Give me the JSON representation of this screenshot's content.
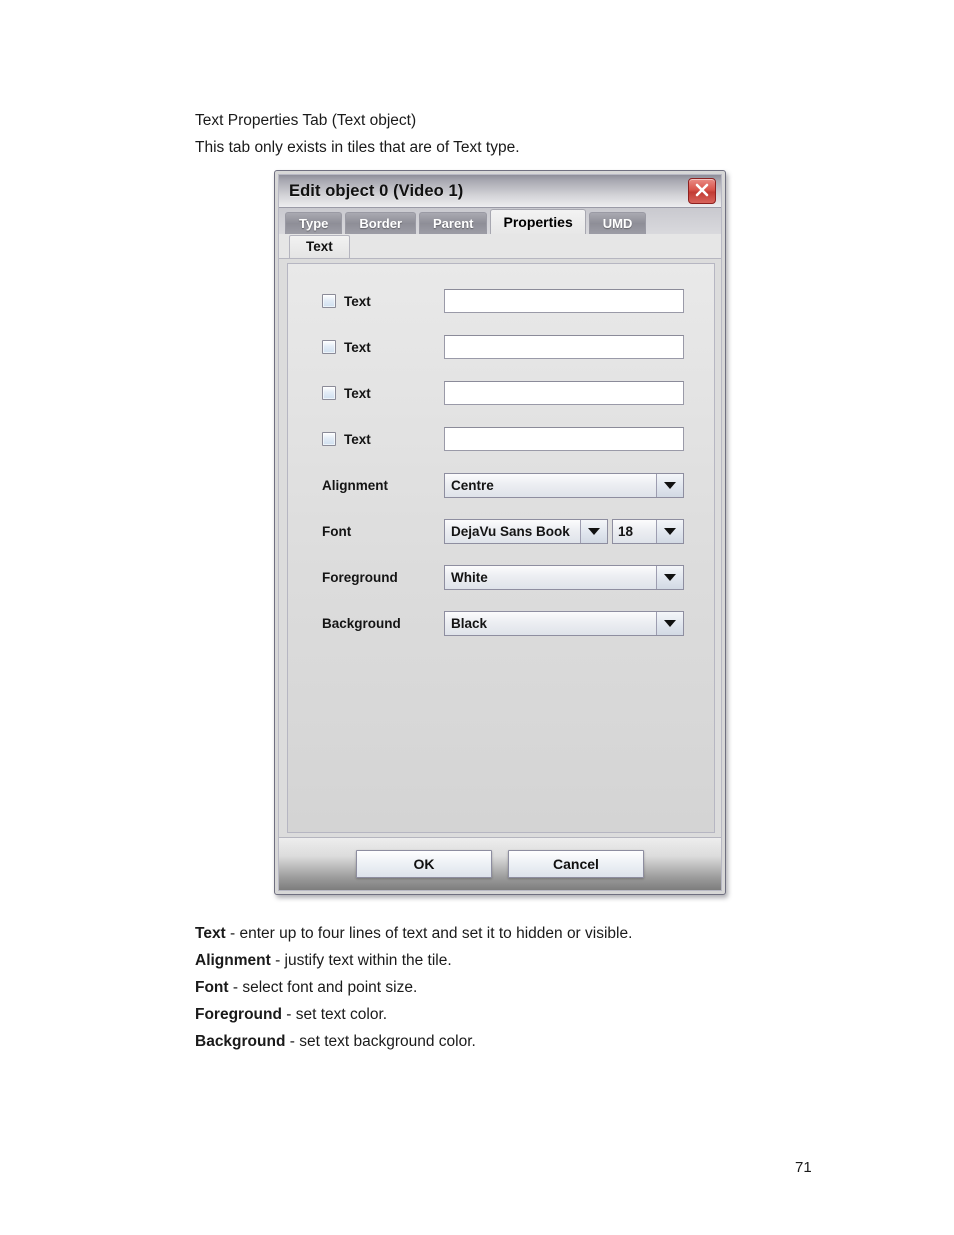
{
  "document": {
    "intro_line_1": "Text Properties Tab (Text object)",
    "intro_line_2": "This tab only exists in tiles that are of Text type.",
    "page_number": "71",
    "descriptions": [
      {
        "term": "Text",
        "rest": " - enter up to four lines of text and set it to hidden or visible."
      },
      {
        "term": "Alignment",
        "rest": " - justify text within the tile."
      },
      {
        "term": "Font",
        "rest": " - select font and point size."
      },
      {
        "term": "Foreground",
        "rest": " - set text color."
      },
      {
        "term": "Background",
        "rest": " - set text background color."
      }
    ]
  },
  "dialog": {
    "title": "Edit object 0 (Video 1)",
    "close_icon": "close-icon",
    "tabs": [
      {
        "label": "Type",
        "active": false
      },
      {
        "label": "Border",
        "active": false
      },
      {
        "label": "Parent",
        "active": false
      },
      {
        "label": "Properties",
        "active": true
      },
      {
        "label": "UMD",
        "active": false
      }
    ],
    "subtabs": [
      {
        "label": "Text",
        "active": true
      }
    ],
    "text_rows": [
      {
        "label": "Text",
        "value": "",
        "checked": false
      },
      {
        "label": "Text",
        "value": "",
        "checked": false
      },
      {
        "label": "Text",
        "value": "",
        "checked": false
      },
      {
        "label": "Text",
        "value": "",
        "checked": false
      }
    ],
    "alignment": {
      "label": "Alignment",
      "value": "Centre"
    },
    "font": {
      "label": "Font",
      "family_value": "DejaVu Sans Book",
      "size_value": "18"
    },
    "foreground": {
      "label": "Foreground",
      "value": "White"
    },
    "background": {
      "label": "Background",
      "value": "Black"
    },
    "buttons": {
      "ok": "OK",
      "cancel": "Cancel"
    },
    "colors": {
      "close_button": "#c23c34",
      "titlebar_dark": "#8e8e99",
      "panel": "#dcdcdc",
      "tab_inactive": "#8e8e97"
    }
  }
}
